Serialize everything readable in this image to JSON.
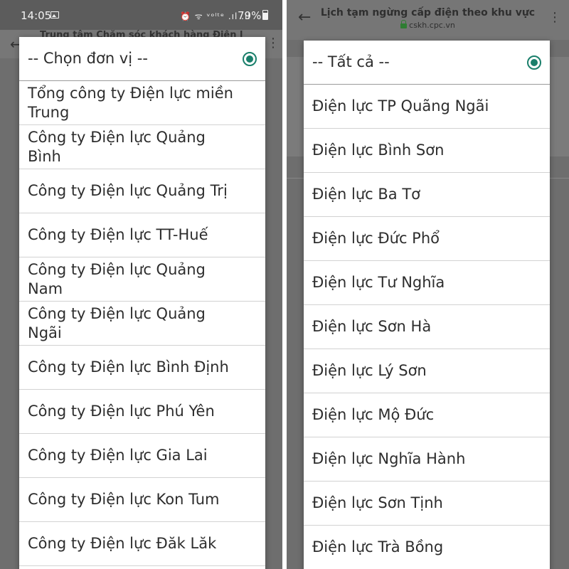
{
  "left": {
    "status_bar": {
      "time": "14:05",
      "status_icons": "⏰ ᯤ ᵛᵒˡᵗᵉ .ıl .ıl",
      "battery": "79%"
    },
    "app_title": "Trung tâm Chăm sóc khách hàng Điện l",
    "dialog": {
      "options": [
        {
          "label": "-- Chọn đơn vị --",
          "selected": true
        },
        {
          "label": "Tổng công ty Điện lực miền Trung",
          "selected": false
        },
        {
          "label": "Công ty Điện lực Quảng Bình",
          "selected": false
        },
        {
          "label": "Công ty Điện lực Quảng Trị",
          "selected": false
        },
        {
          "label": "Công ty Điện lực TT-Huế",
          "selected": false
        },
        {
          "label": "Công ty Điện lực Quảng Nam",
          "selected": false
        },
        {
          "label": "Công ty Điện lực Quảng Ngãi",
          "selected": false
        },
        {
          "label": "Công ty Điện lực Bình Định",
          "selected": false
        },
        {
          "label": "Công ty Điện lực Phú Yên",
          "selected": false
        },
        {
          "label": "Công ty Điện lực Gia Lai",
          "selected": false
        },
        {
          "label": "Công ty Điện lực Kon Tum",
          "selected": false
        },
        {
          "label": "Công ty Điện lực Đăk Lăk",
          "selected": false
        }
      ]
    }
  },
  "right": {
    "browser": {
      "page_title": "Lịch tạm ngừng cấp điện theo khu vực",
      "url": "cskh.cpc.vn"
    },
    "dialog": {
      "options": [
        {
          "label": "-- Tất cả --",
          "selected": true
        },
        {
          "label": "Điện lực TP Quãng Ngãi",
          "selected": false
        },
        {
          "label": "Điện lực Bình Sơn",
          "selected": false
        },
        {
          "label": "Điện lực Ba Tơ",
          "selected": false
        },
        {
          "label": "Điện lực Đức Phổ",
          "selected": false
        },
        {
          "label": "Điện lực Tư Nghĩa",
          "selected": false
        },
        {
          "label": "Điện lực Sơn Hà",
          "selected": false
        },
        {
          "label": "Điện lực Lý Sơn",
          "selected": false
        },
        {
          "label": "Điện lực Mộ Đức",
          "selected": false
        },
        {
          "label": "Điện lực Nghĩa Hành",
          "selected": false
        },
        {
          "label": "Điện lực Sơn Tịnh",
          "selected": false
        },
        {
          "label": "Điện lực Trà Bồng",
          "selected": false
        }
      ]
    }
  },
  "colors": {
    "accent": "#1a7f6b",
    "scrim": "#6e6e6e",
    "dialog_bg": "#ffffff",
    "text": "#2d2d2d"
  }
}
